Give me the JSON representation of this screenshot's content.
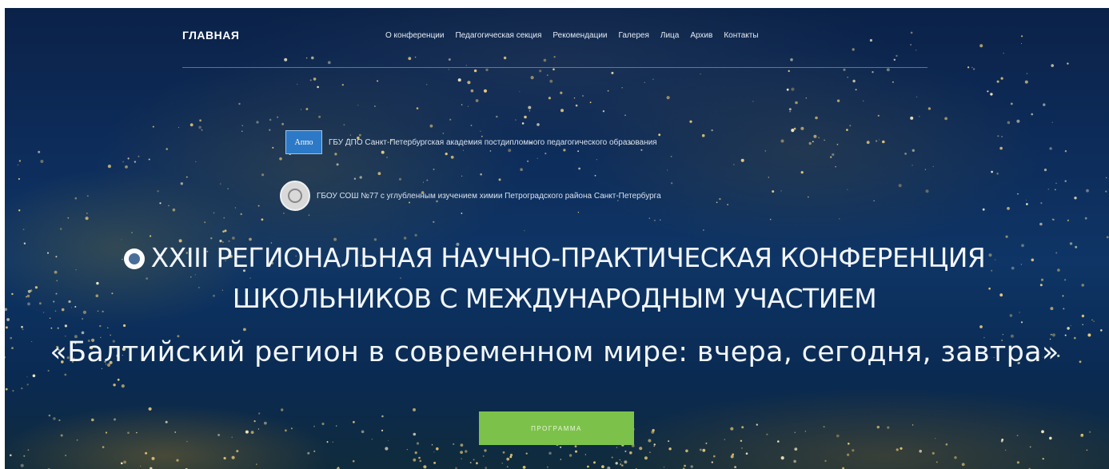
{
  "nav": {
    "brand": "ГЛАВНАЯ",
    "items": [
      {
        "label": "О конференции"
      },
      {
        "label": "Педагогическая секция"
      },
      {
        "label": "Рекомендации"
      },
      {
        "label": "Галерея"
      },
      {
        "label": "Лица"
      },
      {
        "label": "Архив"
      },
      {
        "label": "Контакты"
      }
    ]
  },
  "organizations": [
    {
      "logo_text": "Аппо",
      "name": "ГБУ ДПО Санкт-Петербургская академия постдипломного педагогического образования"
    },
    {
      "name": "ГБОУ СОШ №77 с углубленным изучением химии Петроградского района Санкт-Петербурга"
    }
  ],
  "hero": {
    "title_line1": "XXIII РЕГИОНАЛЬНАЯ НАУЧНО-ПРАКТИЧЕСКАЯ КОНФЕРЕНЦИЯ",
    "title_line2": "ШКОЛЬНИКОВ С МЕЖДУНАРОДНЫМ УЧАСТИЕМ",
    "subtitle": "«Балтийский регион в современном мире: вчера, сегодня, завтра»",
    "button_label": "ПРОГРАММА"
  },
  "colors": {
    "button": "#7cc24a",
    "background": "#0d2c5a",
    "text": "#f2f6fb"
  },
  "icons": [
    "appo-logo-icon",
    "school-emblem-icon",
    "conference-logo-icon"
  ]
}
